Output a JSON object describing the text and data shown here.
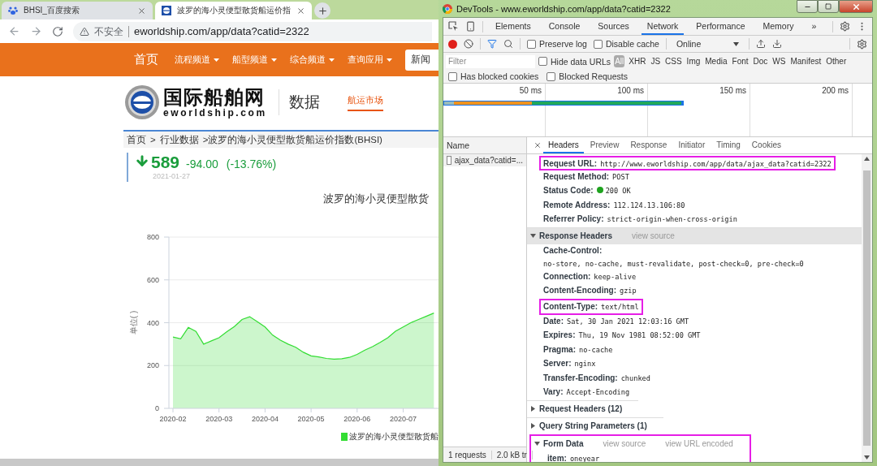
{
  "browser": {
    "tabs": [
      {
        "kind": "search",
        "title": "BHSI_百度搜索",
        "selected": false
      },
      {
        "kind": "site",
        "title": "波罗的海小灵便型散货船运价指",
        "selected": true
      }
    ],
    "security": "不安全",
    "url": "eworldship.com/app/data?catid=2322"
  },
  "site_nav": {
    "items": [
      {
        "kind": "home",
        "label": "首页"
      },
      {
        "kind": "menu",
        "label": "流程频道"
      },
      {
        "kind": "menu",
        "label": "船型频道"
      },
      {
        "kind": "menu",
        "label": "综合频道"
      },
      {
        "kind": "menu",
        "label": "查询应用"
      }
    ],
    "search_scope": "新闻"
  },
  "header": {
    "logo_cn": "国际船舶网",
    "logo_en": "eworldship.com",
    "section": "数据",
    "subnav": {
      "label": "航运市场",
      "selected": true
    }
  },
  "breadcrumb": [
    "首页",
    ">",
    "行业数据",
    ">波罗的海小灵便型散货船运价指数(BHSI)"
  ],
  "index": {
    "falling": true,
    "value": "589",
    "change": "-94.00",
    "percent": "(-13.76%)",
    "date": "2021-01-27"
  },
  "chart": {
    "chart_data": {
      "type": "area",
      "title": "波罗的海小灵便型散货",
      "ylabel": "单位( )",
      "categories": [
        "2020-02",
        null,
        null,
        null,
        null,
        null,
        "2020-03",
        null,
        null,
        null,
        null,
        null,
        "2020-04",
        null,
        null,
        null,
        null,
        null,
        "2020-05",
        null,
        null,
        null,
        null,
        null,
        "2020-06",
        null,
        null,
        null,
        null,
        null,
        "2020-07",
        null,
        null,
        null,
        null
      ],
      "series": [
        {
          "name": "波罗的海小灵便型散货船",
          "color": "#33dd33",
          "values": [
            333,
            325,
            378,
            360,
            300,
            315,
            330,
            357,
            382,
            415,
            428,
            405,
            380,
            342,
            318,
            300,
            285,
            262,
            245,
            240,
            233,
            230,
            232,
            238,
            252,
            272,
            288,
            308,
            330,
            360,
            380,
            400,
            415,
            430,
            445
          ]
        }
      ],
      "ylim": [
        0,
        800
      ],
      "yticks": [
        0,
        200,
        400,
        600,
        800
      ],
      "grid": true
    }
  },
  "devtools": {
    "title": "DevTools - www.eworldship.com/app/data?catid=2322",
    "tabs": [
      {
        "label": "Elements",
        "selected": false
      },
      {
        "label": "Console",
        "selected": false
      },
      {
        "label": "Sources",
        "selected": false
      },
      {
        "label": "Network",
        "selected": true
      },
      {
        "label": "Performance",
        "selected": false
      },
      {
        "label": "Memory",
        "selected": false
      }
    ],
    "more_tabs": "»",
    "recording": true,
    "preserve_log": {
      "label": "Preserve log",
      "checked": false
    },
    "disable_cache": {
      "label": "Disable cache",
      "checked": false
    },
    "throttling": "Online",
    "filter": {
      "placeholder": "Filter"
    },
    "hide_data_urls": {
      "label": "Hide data URLs",
      "checked": false
    },
    "types": [
      {
        "label": "All",
        "selected": true
      },
      {
        "label": "XHR",
        "selected": false
      },
      {
        "label": "JS",
        "selected": false
      },
      {
        "label": "CSS",
        "selected": false
      },
      {
        "label": "Img",
        "selected": false
      },
      {
        "label": "Media",
        "selected": false
      },
      {
        "label": "Font",
        "selected": false
      },
      {
        "label": "Doc",
        "selected": false
      },
      {
        "label": "WS",
        "selected": false
      },
      {
        "label": "Manifest",
        "selected": false
      },
      {
        "label": "Other",
        "selected": false
      }
    ],
    "blocked_filters": [
      {
        "label": "Has blocked cookies",
        "checked": false
      },
      {
        "label": "Blocked Requests",
        "checked": false
      }
    ],
    "overview_ticks": [
      "50 ms",
      "100 ms",
      "150 ms",
      "200 ms"
    ],
    "name_column": "Name",
    "requests": [
      {
        "name": "ajax_data?catid=...",
        "selected": false
      }
    ],
    "footer": [
      "1 requests",
      "2.0 kB tr"
    ],
    "detail_tabs": [
      {
        "label": "Headers",
        "selected": true
      },
      {
        "label": "Preview",
        "selected": false
      },
      {
        "label": "Response",
        "selected": false
      },
      {
        "label": "Initiator",
        "selected": false
      },
      {
        "label": "Timing",
        "selected": false
      },
      {
        "label": "Cookies",
        "selected": false
      }
    ],
    "general": [
      {
        "kind": "plain",
        "key": "Request URL:",
        "value": "http://www.eworldship.com/app/data/ajax_data?catid=2322",
        "highlighted": true
      },
      {
        "kind": "plain",
        "key": "Request Method:",
        "value": "POST",
        "highlighted": false
      },
      {
        "kind": "status",
        "key": "Status Code:",
        "value": "200 OK",
        "highlighted": false
      },
      {
        "kind": "plain",
        "key": "Remote Address:",
        "value": "112.124.13.106:80",
        "highlighted": false
      },
      {
        "kind": "plain",
        "key": "Referrer Policy:",
        "value": "strict-origin-when-cross-origin",
        "highlighted": false
      }
    ],
    "sections": [
      {
        "title": "Response Headers",
        "expanded": true,
        "hovered": true,
        "highlighted": false,
        "links": [
          "view source"
        ],
        "rows": [
          {
            "key": "Cache-Control:",
            "value": "no-store, no-cache, must-revalidate, post-check=0, pre-check=0",
            "highlighted": false
          },
          {
            "key": "Connection:",
            "value": "keep-alive",
            "highlighted": false
          },
          {
            "key": "Content-Encoding:",
            "value": "gzip",
            "highlighted": false
          },
          {
            "key": "Content-Type:",
            "value": "text/html",
            "highlighted": true
          },
          {
            "key": "Date:",
            "value": "Sat, 30 Jan 2021 12:03:16 GMT",
            "highlighted": false
          },
          {
            "key": "Expires:",
            "value": "Thu, 19 Nov 1981 08:52:00 GMT",
            "highlighted": false
          },
          {
            "key": "Pragma:",
            "value": "no-cache",
            "highlighted": false
          },
          {
            "key": "Server:",
            "value": "nginx",
            "highlighted": false
          },
          {
            "key": "Transfer-Encoding:",
            "value": "chunked",
            "highlighted": false
          },
          {
            "key": "Vary:",
            "value": "Accept-Encoding",
            "highlighted": false
          }
        ]
      },
      {
        "title": "Request Headers (12)",
        "expanded": false,
        "hovered": false,
        "highlighted": false
      },
      {
        "title": "Query String Parameters (1)",
        "expanded": false,
        "hovered": false,
        "highlighted": false
      },
      {
        "title": "Form Data",
        "expanded": true,
        "hovered": false,
        "highlighted": true,
        "links": [
          "view source",
          "view URL encoded"
        ],
        "rows": [
          {
            "key": "item:",
            "value": "oneyear",
            "highlighted": false
          }
        ]
      }
    ]
  }
}
